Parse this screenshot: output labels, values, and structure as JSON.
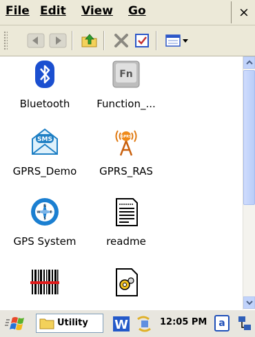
{
  "menubar": {
    "items": [
      {
        "label": "File"
      },
      {
        "label": "Edit"
      },
      {
        "label": "View"
      },
      {
        "label": "Go"
      }
    ],
    "close_label": "×"
  },
  "toolbar": {
    "buttons": [
      "back-icon",
      "forward-icon",
      "up-folder-icon",
      "delete-icon",
      "properties-icon",
      "views-icon"
    ]
  },
  "files": [
    {
      "label": "Bluetooth",
      "icon": "bluetooth-icon"
    },
    {
      "label": "Function_...",
      "icon": "function-key-icon"
    },
    {
      "label": "GPRS_Demo",
      "icon": "sms-envelope-icon"
    },
    {
      "label": "GPRS_RAS",
      "icon": "gprs-antenna-icon"
    },
    {
      "label": "GPS System",
      "icon": "compass-icon"
    },
    {
      "label": "readme",
      "icon": "text-document-icon"
    },
    {
      "label": "",
      "icon": "barcode-icon"
    },
    {
      "label": "",
      "icon": "settings-file-icon"
    }
  ],
  "taskbar": {
    "task_label": "Utility",
    "time": "12:05 PM",
    "input_indicator": "a"
  },
  "colors": {
    "bar_bg": "#ece9d8",
    "accent_blue": "#1f5fd6",
    "scroll_blue": "#c1d3fb"
  }
}
